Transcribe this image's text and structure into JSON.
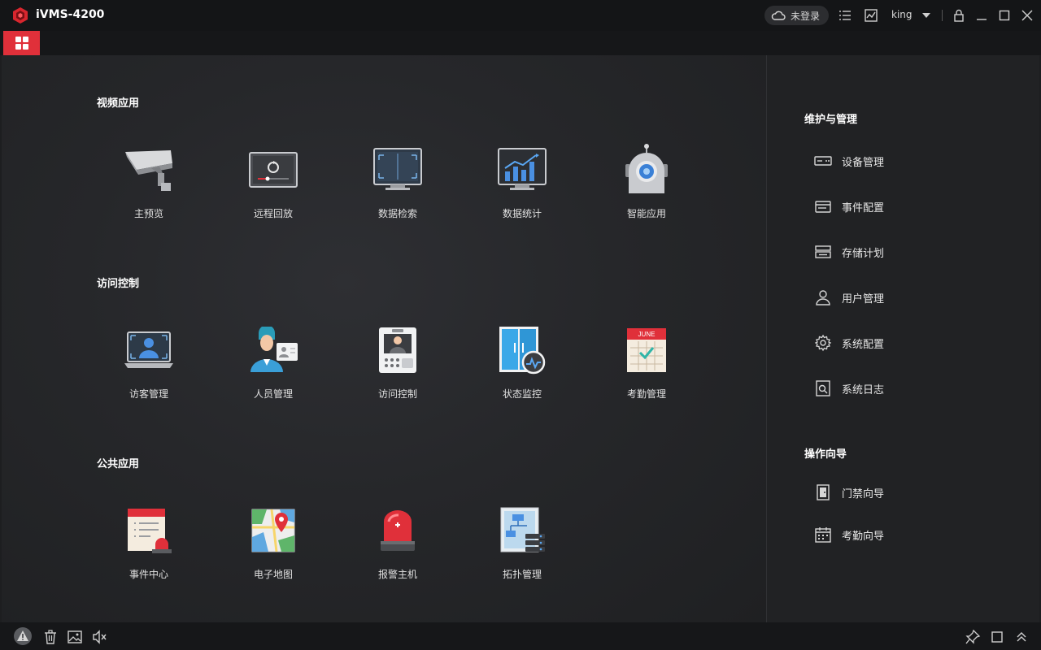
{
  "titlebar": {
    "app_title": "iVMS-4200",
    "cloud_status": "未登录",
    "user": "king"
  },
  "colors": {
    "accent_red": "#e0303a",
    "background": "#1d1e20",
    "panel": "#212224"
  },
  "main": {
    "sections": [
      {
        "title": "视频应用",
        "tiles": [
          {
            "label": "主预览",
            "icon": "camera-icon"
          },
          {
            "label": "远程回放",
            "icon": "playback-icon"
          },
          {
            "label": "数据检索",
            "icon": "data-search-icon"
          },
          {
            "label": "数据统计",
            "icon": "statistics-icon"
          },
          {
            "label": "智能应用",
            "icon": "smart-robot-icon"
          }
        ]
      },
      {
        "title": "访问控制",
        "tiles": [
          {
            "label": "访客管理",
            "icon": "visitor-icon"
          },
          {
            "label": "人员管理",
            "icon": "person-management-icon"
          },
          {
            "label": "访问控制",
            "icon": "intercom-icon"
          },
          {
            "label": "状态监控",
            "icon": "door-monitor-icon"
          },
          {
            "label": "考勤管理",
            "icon": "calendar-icon"
          }
        ]
      },
      {
        "title": "公共应用",
        "tiles": [
          {
            "label": "事件中心",
            "icon": "event-center-icon"
          },
          {
            "label": "电子地图",
            "icon": "map-icon"
          },
          {
            "label": "报警主机",
            "icon": "alarm-light-icon"
          },
          {
            "label": "拓扑管理",
            "icon": "topology-icon"
          }
        ]
      }
    ]
  },
  "right_panel": {
    "maintenance": {
      "title": "维护与管理",
      "items": [
        {
          "label": "设备管理",
          "icon": "device-icon"
        },
        {
          "label": "事件配置",
          "icon": "event-config-icon"
        },
        {
          "label": "存储计划",
          "icon": "storage-icon"
        },
        {
          "label": "用户管理",
          "icon": "user-icon"
        },
        {
          "label": "系统配置",
          "icon": "gear-icon"
        },
        {
          "label": "系统日志",
          "icon": "log-icon"
        }
      ]
    },
    "wizard": {
      "title": "操作向导",
      "items": [
        {
          "label": "门禁向导",
          "icon": "door-icon"
        },
        {
          "label": "考勤向导",
          "icon": "attendance-calendar-icon"
        }
      ]
    }
  },
  "calendar_month": "JUNE"
}
